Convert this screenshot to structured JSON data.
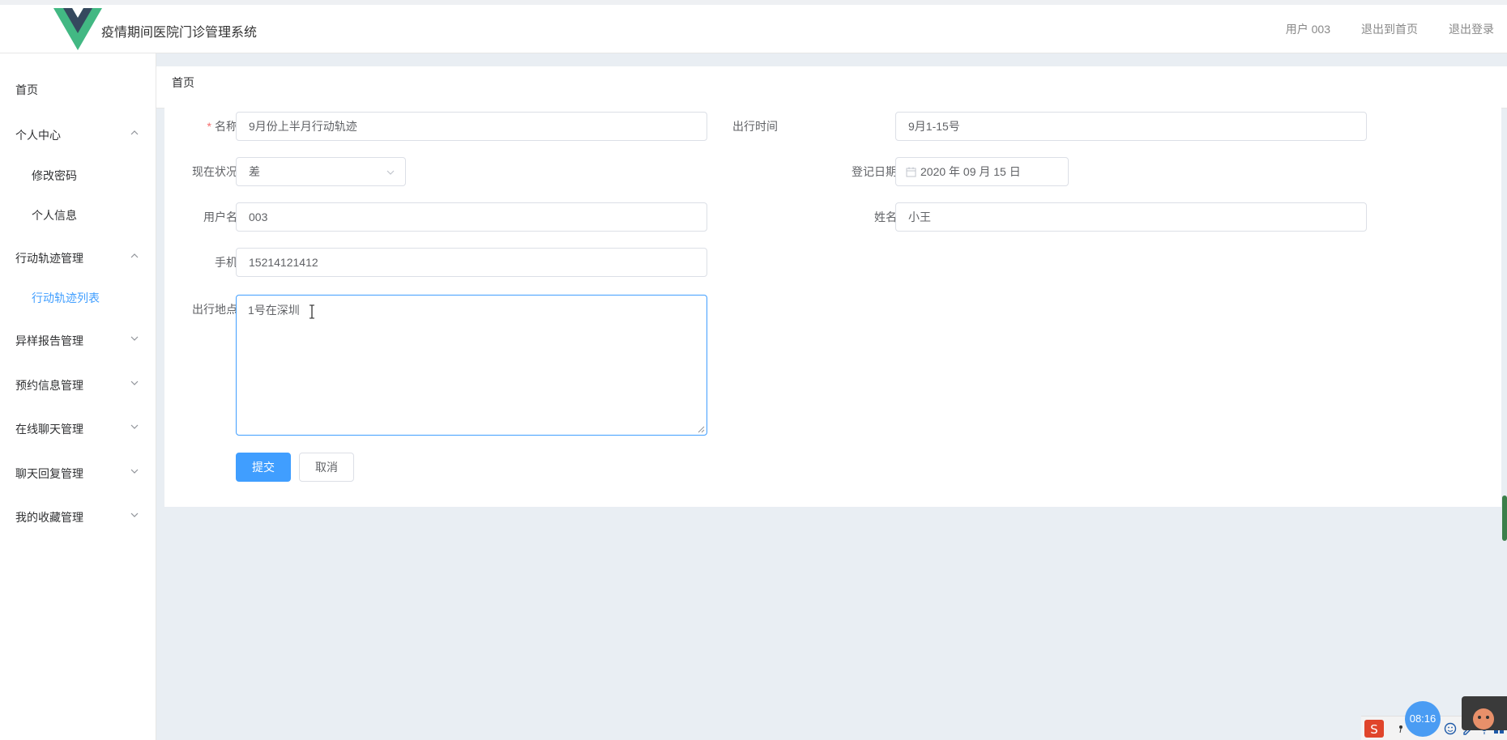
{
  "header": {
    "title": "疫情期间医院门诊管理系统",
    "user": "用户 003",
    "back_home": "退出到首页",
    "logout": "退出登录"
  },
  "sidebar": {
    "home": "首页",
    "personal_center": "个人中心",
    "change_password": "修改密码",
    "personal_info": "个人信息",
    "track_mgmt": "行动轨迹管理",
    "track_list": "行动轨迹列表",
    "abnormal_report": "异样报告管理",
    "appointment": "预约信息管理",
    "online_chat": "在线聊天管理",
    "chat_reply": "聊天回复管理",
    "favorites": "我的收藏管理"
  },
  "breadcrumb": "首页",
  "form": {
    "name_label": "名称",
    "name_value": "9月份上半月行动轨迹",
    "travel_time_label": "出行时间",
    "travel_time_value": "9月1-15号",
    "status_label": "现在状况",
    "status_value": "差",
    "register_date_label": "登记日期",
    "register_date_value": "2020 年 09 月 15 日",
    "username_label": "用户名",
    "username_value": "003",
    "realname_label": "姓名",
    "realname_value": "小王",
    "phone_label": "手机",
    "phone_value": "15214121412",
    "location_label": "出行地点",
    "location_value": "1号在深圳",
    "submit": "提交",
    "cancel": "取消"
  },
  "system": {
    "clock": "08:16"
  },
  "colors": {
    "accent": "#409eff",
    "required": "#f56c6c",
    "logo_green": "#42b883",
    "logo_dark": "#35495e"
  }
}
